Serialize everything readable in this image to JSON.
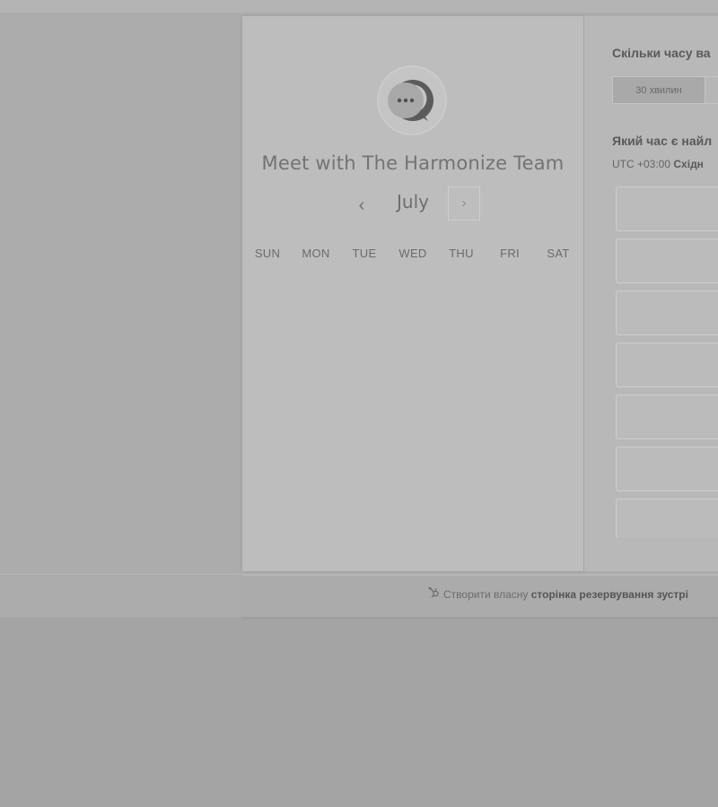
{
  "booking": {
    "title": "Meet with The Harmonize Team",
    "avatar_icon": "chat-bubble-icon"
  },
  "calendar": {
    "month": "July",
    "prev_icon": "‹",
    "next_icon": "›",
    "weekdays": [
      "SUN",
      "MON",
      "TUE",
      "WED",
      "THU",
      "FRI",
      "SAT"
    ]
  },
  "duration": {
    "question": "Скільки часу ва",
    "options": [
      "30 хвилин",
      ""
    ],
    "selected": "30 хвилин"
  },
  "time": {
    "question": "Який час є найл",
    "timezone_offset": "UTC +03:00",
    "timezone_name": "Східн",
    "slots": [
      "",
      "",
      "",
      "",
      "",
      "",
      ""
    ]
  },
  "footer": {
    "prefix": "Створити власну",
    "link": "сторінка резервування зустрі"
  },
  "colors": {
    "page_bg": "#a4a4a4",
    "panel_bg": "#bdbdbd",
    "text_title": "#737373"
  }
}
